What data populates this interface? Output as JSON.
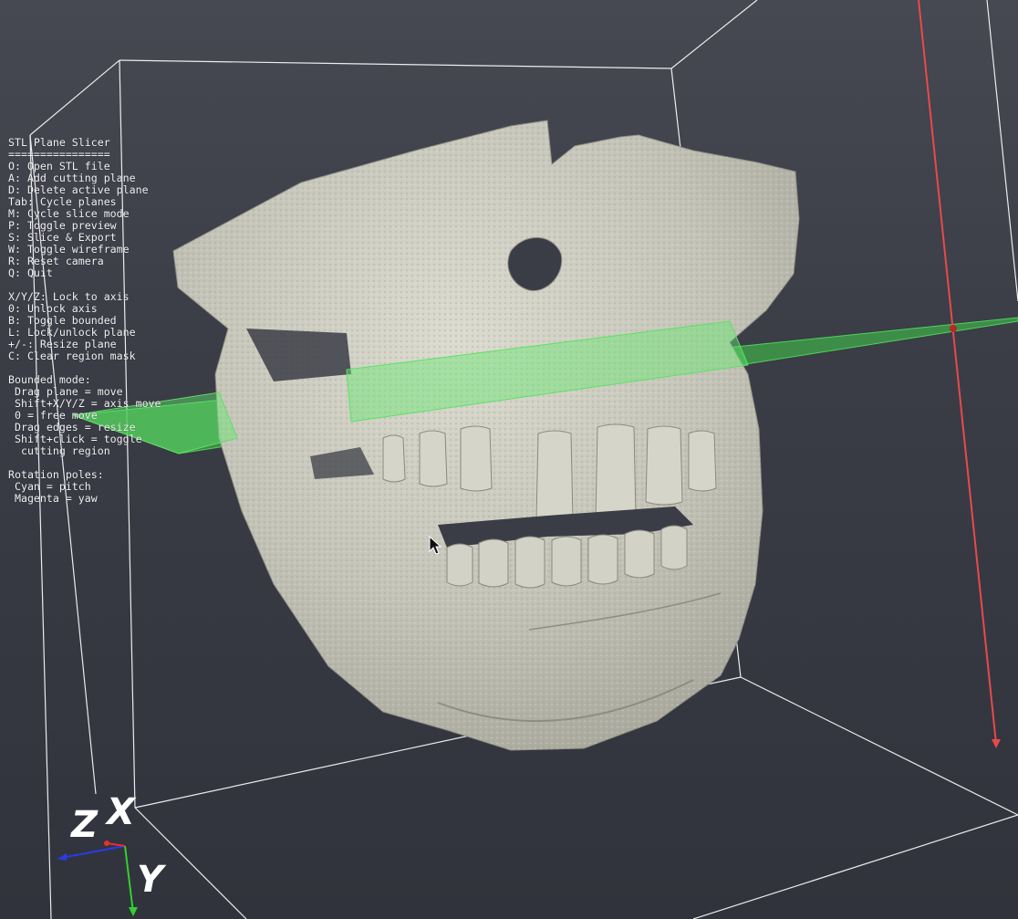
{
  "app": {
    "title": "STL Plane Slicer"
  },
  "help": {
    "lines": [
      "STL Plane Slicer",
      "================",
      "O: Open STL file",
      "A: Add cutting plane",
      "D: Delete active plane",
      "Tab: Cycle planes",
      "M: Cycle slice mode",
      "P: Toggle preview",
      "S: Slice & Export",
      "W: Toggle wireframe",
      "R: Reset camera",
      "Q: Quit",
      "",
      "X/Y/Z: Lock to axis",
      "0: Unlock axis",
      "B: Toggle bounded",
      "L: Lock/unlock plane",
      "+/-: Resize plane",
      "C: Clear region mask",
      "",
      "Bounded mode:",
      " Drag plane = move",
      " Shift+X/Y/Z = axis move",
      " 0 = free move",
      " Drag edges = resize",
      " Shift+click = toggle",
      "  cutting region",
      "",
      "Rotation poles:",
      " Cyan = pitch",
      " Magenta = yaw"
    ]
  },
  "axes": {
    "x_label": "X",
    "y_label": "Y",
    "z_label": "Z"
  },
  "colors": {
    "background_top": "#464852",
    "background_bottom": "#31333c",
    "bounding_box": "#ffffff",
    "mesh": "#c9c8bd",
    "cutting_plane": "#3fa84a",
    "rotation_pole": "#e84a4a",
    "axis_x": "#e83030",
    "axis_y": "#30d030",
    "axis_z": "#2a3ae8"
  },
  "icons": {
    "cursor": "mouse-pointer-icon"
  }
}
